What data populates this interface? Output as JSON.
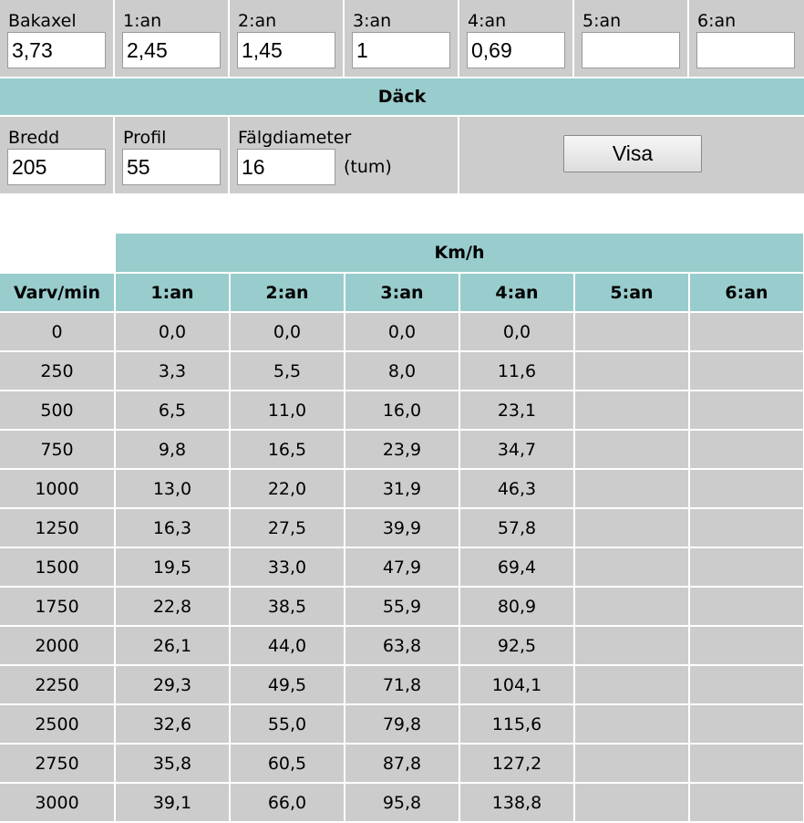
{
  "ratios": [
    {
      "label": "Bakaxel",
      "value": "3,73"
    },
    {
      "label": "1:an",
      "value": "2,45"
    },
    {
      "label": "2:an",
      "value": "1,45"
    },
    {
      "label": "3:an",
      "value": "1"
    },
    {
      "label": "4:an",
      "value": "0,69"
    },
    {
      "label": "5:an",
      "value": ""
    },
    {
      "label": "6:an",
      "value": ""
    }
  ],
  "tires": {
    "header": "Däck",
    "width": {
      "label": "Bredd",
      "value": "205"
    },
    "profile": {
      "label": "Profil",
      "value": "55"
    },
    "rim": {
      "label": "Fälgdiameter",
      "value": "16",
      "unit": "(tum)"
    },
    "button_label": "Visa"
  },
  "speed_table": {
    "group_header": "Km/h",
    "rpm_header": "Varv/min",
    "gear_headers": [
      "1:an",
      "2:an",
      "3:an",
      "4:an",
      "5:an",
      "6:an"
    ],
    "rows": [
      {
        "rpm": "0",
        "speeds": [
          "0,0",
          "0,0",
          "0,0",
          "0,0",
          "",
          ""
        ]
      },
      {
        "rpm": "250",
        "speeds": [
          "3,3",
          "5,5",
          "8,0",
          "11,6",
          "",
          ""
        ]
      },
      {
        "rpm": "500",
        "speeds": [
          "6,5",
          "11,0",
          "16,0",
          "23,1",
          "",
          ""
        ]
      },
      {
        "rpm": "750",
        "speeds": [
          "9,8",
          "16,5",
          "23,9",
          "34,7",
          "",
          ""
        ]
      },
      {
        "rpm": "1000",
        "speeds": [
          "13,0",
          "22,0",
          "31,9",
          "46,3",
          "",
          ""
        ]
      },
      {
        "rpm": "1250",
        "speeds": [
          "16,3",
          "27,5",
          "39,9",
          "57,8",
          "",
          ""
        ]
      },
      {
        "rpm": "1500",
        "speeds": [
          "19,5",
          "33,0",
          "47,9",
          "69,4",
          "",
          ""
        ]
      },
      {
        "rpm": "1750",
        "speeds": [
          "22,8",
          "38,5",
          "55,9",
          "80,9",
          "",
          ""
        ]
      },
      {
        "rpm": "2000",
        "speeds": [
          "26,1",
          "44,0",
          "63,8",
          "92,5",
          "",
          ""
        ]
      },
      {
        "rpm": "2250",
        "speeds": [
          "29,3",
          "49,5",
          "71,8",
          "104,1",
          "",
          ""
        ]
      },
      {
        "rpm": "2500",
        "speeds": [
          "32,6",
          "55,0",
          "79,8",
          "115,6",
          "",
          ""
        ]
      },
      {
        "rpm": "2750",
        "speeds": [
          "35,8",
          "60,5",
          "87,8",
          "127,2",
          "",
          ""
        ]
      },
      {
        "rpm": "3000",
        "speeds": [
          "39,1",
          "66,0",
          "95,8",
          "138,8",
          "",
          ""
        ]
      }
    ]
  },
  "colors": {
    "header_bg": "#99cccc",
    "cell_bg": "#cccccc"
  }
}
